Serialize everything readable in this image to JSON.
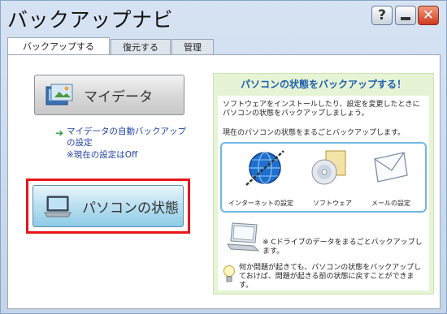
{
  "window": {
    "title": "バックアップナビ",
    "help_label": "?",
    "close_label": "✕"
  },
  "tabs": [
    {
      "label": "バックアップする",
      "active": true
    },
    {
      "label": "復元する",
      "active": false
    },
    {
      "label": "管理",
      "active": false
    }
  ],
  "left": {
    "mydata_button": "マイデータ",
    "link_text": "マイデータの自動バックアップの設定",
    "link_note": "※現在の設定はOff",
    "pc_button": "パソコンの状態"
  },
  "right": {
    "title": "パソコンの状態をバックアップする！",
    "desc1": "ソフトウェアをインストールしたり、設定を変更したときにパソコンの状態をバックアップしましょう。",
    "desc2": "現在のパソコンの状態をまるごとバックアップします。",
    "icons": [
      {
        "label": "インターネットの設定",
        "icon": "globe-icon"
      },
      {
        "label": "ソフトウェア",
        "icon": "cd-icon"
      },
      {
        "label": "メールの設定",
        "icon": "mail-icon"
      }
    ],
    "pc_note": "※ Cドライブのデータをまるごとバックアップします。",
    "tip": "何か問題が起きても、パソコンの状態をバックアップしておけば、問題が起きる前の状態に戻すことができます。"
  },
  "colors": {
    "highlight": "#e8151b",
    "title_blue": "#1f5fae",
    "link_blue": "#2142a4",
    "panel_green": "#e6f4d5"
  }
}
